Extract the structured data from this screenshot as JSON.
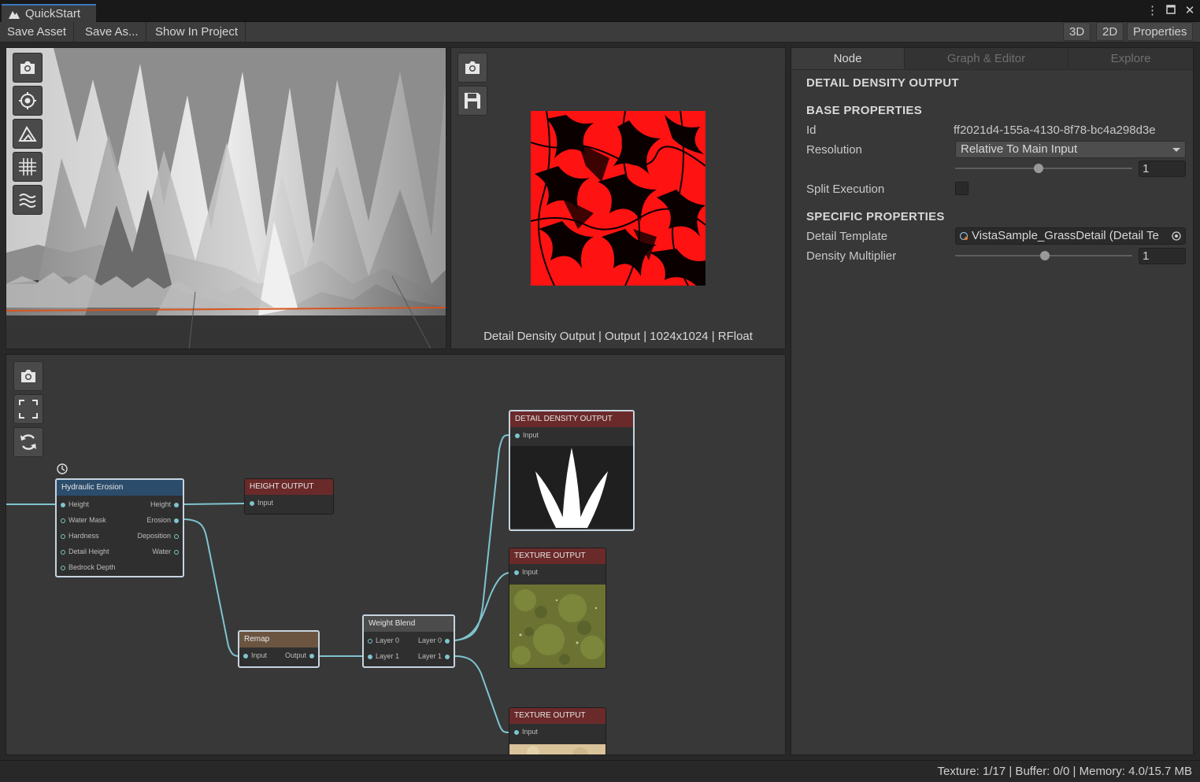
{
  "window": {
    "tab_title": "QuickStart",
    "menu_icon": "kebab-menu-icon",
    "maximize_icon": "maximize-icon",
    "close_icon": "close-icon"
  },
  "toolbar": {
    "save_asset": "Save Asset",
    "save_as": "Save As...",
    "show_in_project": "Show In Project",
    "btn_3d": "3D",
    "btn_2d": "2D",
    "btn_properties": "Properties"
  },
  "viewport3d": {
    "buttons": [
      "camera-icon",
      "focus-target-icon",
      "terrain-icon",
      "grid-icon",
      "water-icon"
    ]
  },
  "preview2d": {
    "buttons": [
      "camera-icon",
      "save-icon"
    ],
    "caption": "Detail Density Output | Output | 1024x1024 | RFloat"
  },
  "graph": {
    "buttons": [
      "camera-icon",
      "frame-all-icon",
      "refresh-icon"
    ],
    "timer_icon": "clock-icon",
    "nodes": {
      "hydraulic": {
        "title": "Hydraulic Erosion",
        "inputs": [
          "Height",
          "Water Mask",
          "Hardness",
          "Detail Height",
          "Bedrock Depth"
        ],
        "outputs": [
          "Height",
          "Erosion",
          "Deposition",
          "Water"
        ]
      },
      "height_output": {
        "title": "HEIGHT OUTPUT",
        "input": "Input"
      },
      "remap": {
        "title": "Remap",
        "input": "Input",
        "output": "Output"
      },
      "weight_blend": {
        "title": "Weight Blend",
        "inputs": [
          "Layer 0",
          "Layer 1"
        ],
        "outputs": [
          "Layer 0",
          "Layer 1"
        ]
      },
      "detail_density": {
        "title": "DETAIL DENSITY OUTPUT",
        "input": "Input"
      },
      "texture_output_1": {
        "title": "TEXTURE OUTPUT",
        "input": "Input"
      },
      "texture_output_2": {
        "title": "TEXTURE OUTPUT",
        "input": "Input"
      }
    }
  },
  "inspector": {
    "tabs": [
      "Node",
      "Graph & Editor",
      "Explore"
    ],
    "node_title": "DETAIL DENSITY OUTPUT",
    "base_header": "BASE PROPERTIES",
    "id_label": "Id",
    "id_value": "ff2021d4-155a-4130-8f78-bc4a298d3e",
    "resolution_label": "Resolution",
    "resolution_value": "Relative To Main Input",
    "resolution_slider": 1,
    "resolution_number": "1",
    "split_label": "Split Execution",
    "split_checked": false,
    "specific_header": "SPECIFIC PROPERTIES",
    "detail_template_label": "Detail Template",
    "detail_template_value": "VistaSample_GrassDetail (Detail Te",
    "density_label": "Density Multiplier",
    "density_number": "1"
  },
  "status": {
    "text": "Texture: 1/17 | Buffer: 0/0 | Memory: 4.0/15.7 MB"
  },
  "colors": {
    "accent": "#3a79bb",
    "wire": "#7fc4cf",
    "output_red": "#ff1010",
    "horizon": "#d9541e"
  }
}
